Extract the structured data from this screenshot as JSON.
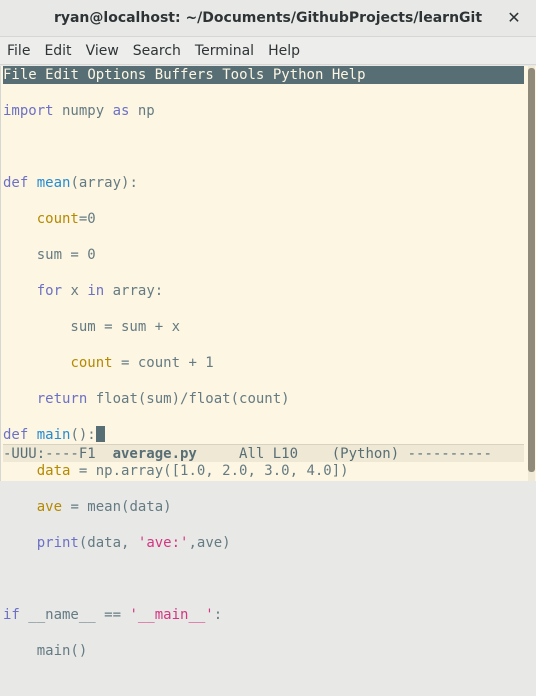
{
  "window": {
    "title": "ryan@localhost: ~/Documents/GithubProjects/learnGit",
    "close_glyph": "✕"
  },
  "terminal_menu": [
    "File",
    "Edit",
    "View",
    "Search",
    "Terminal",
    "Help"
  ],
  "emacs_menu": [
    "File",
    "Edit",
    "Options",
    "Buffers",
    "Tools",
    "Python",
    "Help"
  ],
  "code": {
    "l1": {
      "kw1": "import",
      "mod": " numpy ",
      "kw2": "as",
      "alias": " np"
    },
    "l3": {
      "kw": "def",
      "fn": "mean",
      "rest": "(array):"
    },
    "l4": {
      "indent": "    ",
      "var": "count",
      "rest": "=0"
    },
    "l5": {
      "text": "    sum = 0"
    },
    "l6": {
      "indent": "    ",
      "kw1": "for",
      "mid": " x ",
      "kw2": "in",
      "rest": " array:"
    },
    "l7": {
      "text": "        sum = sum + x"
    },
    "l8": {
      "indent": "        ",
      "var": "count",
      "rest": " = count + 1"
    },
    "l9": {
      "indent": "    ",
      "kw": "return",
      "rest": " float(sum)/float(count)"
    },
    "l10": {
      "kw": "def",
      "fn": "main",
      "rest": "():"
    },
    "l11": {
      "indent": "    ",
      "var": "data",
      "rest": " = np.array([1.0, 2.0, 3.0, 4.0])"
    },
    "l12": {
      "indent": "    ",
      "var": "ave",
      "rest": " = mean(data)"
    },
    "l13": {
      "indent": "    ",
      "kw": "print",
      "pre": "(data, ",
      "str": "'ave:'",
      "post": ",ave)"
    },
    "l15": {
      "kw": "if",
      "mid": " __name__ == ",
      "str": "'__main__'",
      "rest": ":"
    },
    "l16": {
      "text": "    main()"
    }
  },
  "modeline": {
    "left": "-UUU:----F1  ",
    "buffer": "average.py",
    "right": "     All L10    (Python) ----------"
  },
  "colors": {
    "background": "#fdf6e3",
    "menu_bar": "#586e75",
    "keyword": "#6c71c4",
    "function": "#268bd2",
    "variable": "#b58900",
    "string": "#d33682"
  }
}
